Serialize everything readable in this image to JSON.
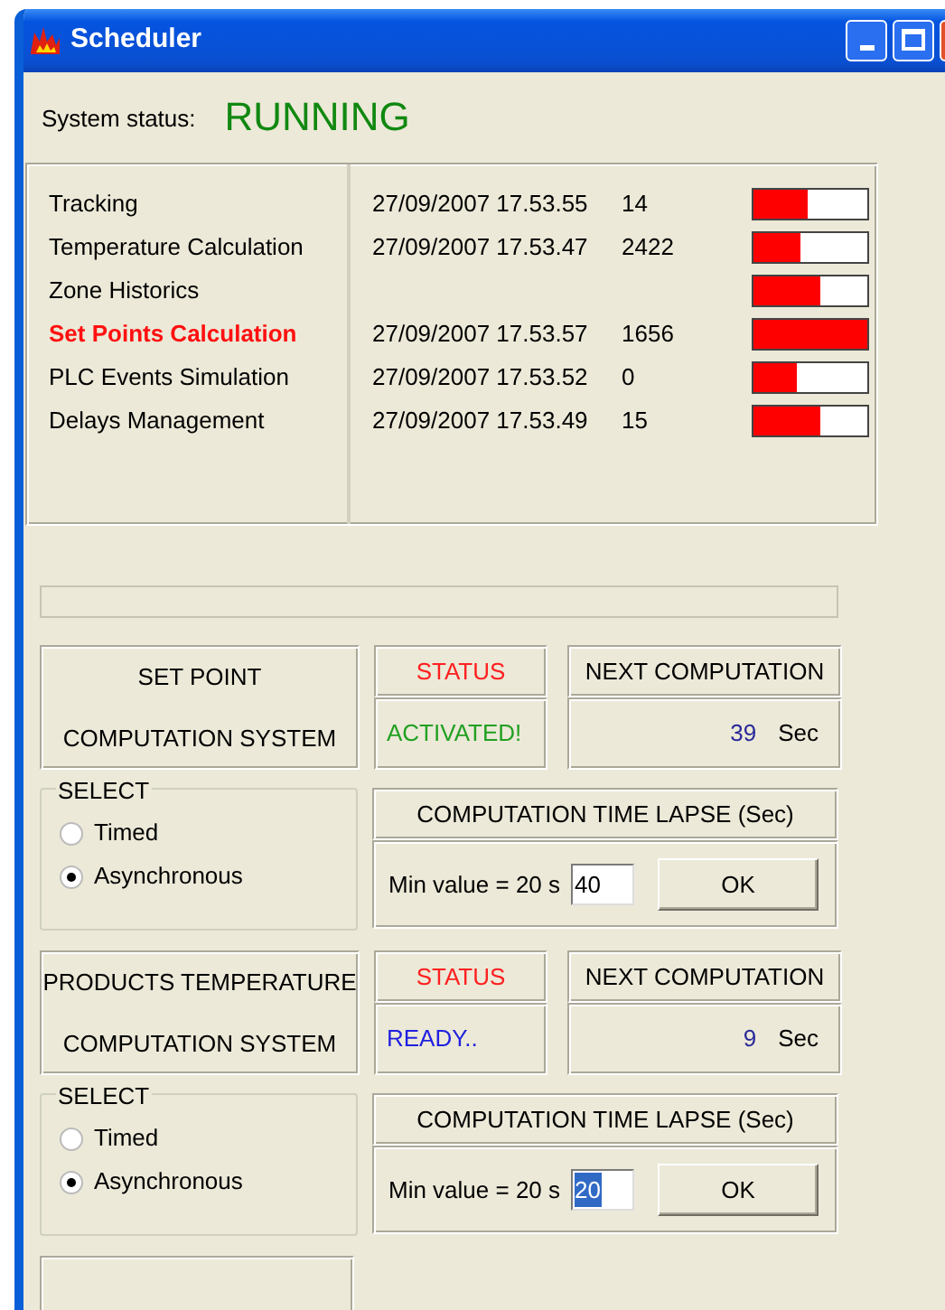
{
  "window": {
    "title": "Scheduler"
  },
  "system_status": {
    "label": "System status:",
    "value": "RUNNING"
  },
  "tasks": [
    {
      "name": "Tracking",
      "highlighted": false,
      "time": "27/09/2007 17.53.55",
      "count": "14",
      "level": 0.48
    },
    {
      "name": "Temperature Calculation",
      "highlighted": false,
      "time": "27/09/2007 17.53.47",
      "count": "2422",
      "level": 0.42
    },
    {
      "name": "Zone Historics",
      "highlighted": false,
      "level": 0.58
    },
    {
      "name": "Set Points Calculation",
      "highlighted": true,
      "time": "27/09/2007 17.53.57",
      "count": "1656",
      "level": 1.0
    },
    {
      "name": "PLC Events Simulation",
      "highlighted": false,
      "time": "27/09/2007 17.53.52",
      "count": "0",
      "level": 0.38
    },
    {
      "name": "Delays Management",
      "highlighted": false,
      "time": "27/09/2007 17.53.49",
      "count": "15",
      "level": 0.58
    }
  ],
  "sections": [
    {
      "title_lines": [
        "SET POINT",
        "COMPUTATION SYSTEM"
      ],
      "status_label": "STATUS",
      "status": {
        "text": "ACTIVATED!",
        "color": "#22a022"
      },
      "next_label": "NEXT COMPUTATION",
      "next_value": "39",
      "next_unit": "Sec",
      "select_legend": "SELECT",
      "options": [
        {
          "label": "Timed",
          "selected": false
        },
        {
          "label": "Asynchronous",
          "selected": true
        }
      ],
      "lapse_title": "COMPUTATION TIME LAPSE (Sec)",
      "min_label": "Min value = 20 s",
      "lapse_value": "40",
      "value_highlighted": false,
      "ok": "OK"
    },
    {
      "title_lines": [
        "PRODUCTS TEMPERATURE",
        "COMPUTATION SYSTEM"
      ],
      "status_label": "STATUS",
      "status": {
        "text": "READY..",
        "color": "#2020e0"
      },
      "next_label": "NEXT COMPUTATION",
      "next_value": "9",
      "next_unit": "Sec",
      "select_legend": "SELECT",
      "options": [
        {
          "label": "Timed",
          "selected": false
        },
        {
          "label": "Asynchronous",
          "selected": true
        }
      ],
      "lapse_title": "COMPUTATION TIME LAPSE (Sec)",
      "min_label": "Min value = 20 s",
      "lapse_value": "20",
      "value_highlighted": true,
      "ok": "OK"
    }
  ]
}
